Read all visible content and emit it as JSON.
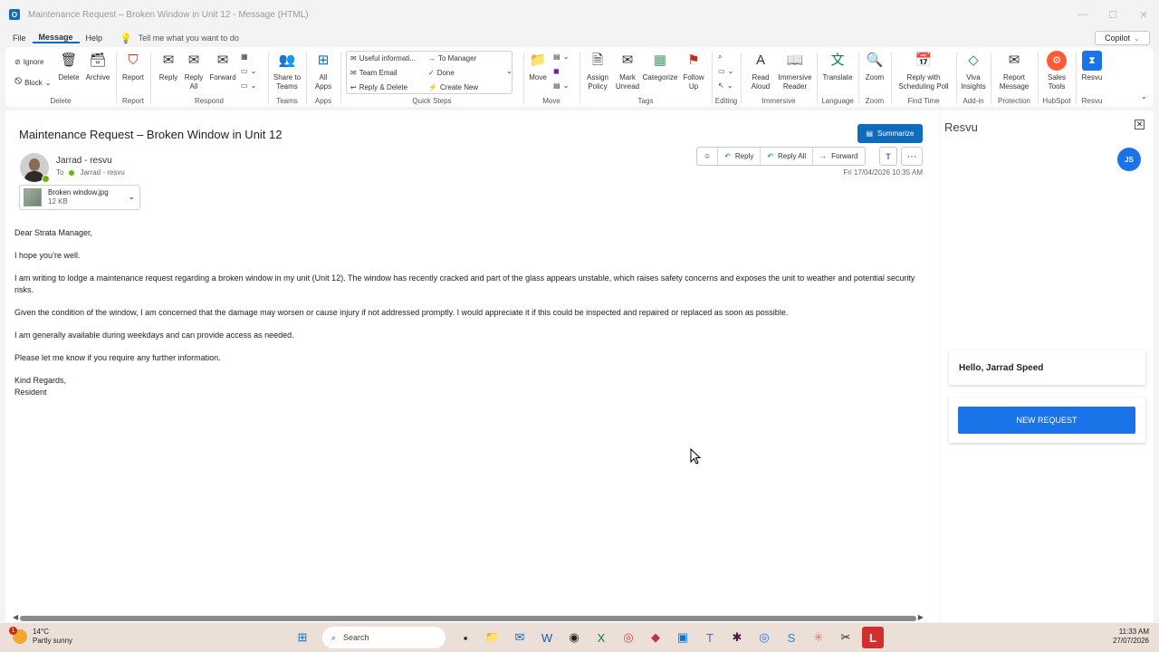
{
  "window": {
    "title": "Maintenance Request – Broken Window in Unit 12  -  Message (HTML)",
    "app_letter": "O"
  },
  "menu": {
    "items": [
      "File",
      "Message",
      "Help"
    ],
    "tellme": "Tell me what you want to do",
    "copilot": "Copilot"
  },
  "ribbon": {
    "delete": {
      "ignore": "Ignore",
      "block": "Block",
      "delete": "Delete",
      "archive": "Archive",
      "label": "Delete"
    },
    "report": {
      "report": "Report",
      "label": "Report"
    },
    "respond": {
      "reply": "Reply",
      "reply_all": "Reply All",
      "forward": "Forward",
      "label": "Respond"
    },
    "teams": {
      "share": "Share to Teams",
      "label": "Teams"
    },
    "apps": {
      "all_apps": "All Apps",
      "label": "Apps"
    },
    "quick_steps": {
      "items": [
        "Useful informati...",
        "To Manager",
        "Team Email",
        "Done",
        "Reply & Delete",
        "Create New"
      ],
      "label": "Quick Steps"
    },
    "move": {
      "move": "Move",
      "label": "Move"
    },
    "tags": {
      "assign_policy": "Assign Policy",
      "mark_unread": "Mark Unread",
      "categorize": "Categorize",
      "follow_up": "Follow Up",
      "label": "Tags"
    },
    "editing": {
      "label": "Editing"
    },
    "immersive": {
      "read_aloud": "Read Aloud",
      "immersive_reader": "Immersive Reader",
      "label": "Immersive"
    },
    "language": {
      "translate": "Translate",
      "label": "Language"
    },
    "zoom": {
      "zoom": "Zoom",
      "label": "Zoom"
    },
    "find_time": {
      "reply_poll": "Reply with Scheduling Poll",
      "label": "Find Time"
    },
    "addin": {
      "viva": "Viva Insights",
      "label": "Add-in"
    },
    "protection": {
      "report_message": "Report Message",
      "label": "Protection"
    },
    "hubspot": {
      "sales_tools": "Sales Tools",
      "label": "HubSpot"
    },
    "resvu": {
      "resvu": "Resvu",
      "label": "Resvu"
    }
  },
  "email": {
    "subject": "Maintenance Request – Broken Window in Unit 12",
    "summarize": "Summarize",
    "sender": "Jarrad - resvu",
    "to_label": "To",
    "to": "Jarrad - resvu",
    "actions": {
      "reply": "Reply",
      "reply_all": "Reply All",
      "forward": "Forward"
    },
    "date": "Fri 17/04/2026 10:35 AM",
    "attachment": {
      "name": "Broken window.jpg",
      "size": "12 KB"
    },
    "body": [
      "Dear Strata Manager,",
      "I hope you’re well.",
      "I am writing to lodge a maintenance request regarding a broken window in my unit (Unit 12). The window has recently cracked and part of the glass appears unstable, which raises safety concerns and exposes the unit to weather and potential security risks.",
      "Given the condition of the window, I am concerned that the damage may worsen or cause injury if not addressed promptly. I would appreciate it if this could be inspected and repaired or replaced as soon as possible.",
      "I am generally available during weekdays and can provide access as needed.",
      "Please let me know if you require any further information."
    ],
    "signoff": "Kind Regards,",
    "signature": "Resident"
  },
  "pane": {
    "title": "Resvu",
    "initials": "JS",
    "greeting": "Hello, Jarrad Speed",
    "new_request": "NEW REQUEST"
  },
  "taskbar": {
    "temp": "14°C",
    "weather": "Partly sunny",
    "badge": "1",
    "search": "Search",
    "time": "11:33 AM",
    "date": "27/07/2026"
  }
}
